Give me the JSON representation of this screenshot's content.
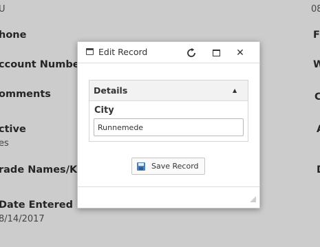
{
  "background": {
    "left_fields": [
      {
        "label": "",
        "value": "U"
      },
      {
        "label": "hone",
        "value": ""
      },
      {
        "label": "ccount Number",
        "value": ""
      },
      {
        "label": "omments",
        "value": ""
      },
      {
        "label": "ctive",
        "value": "es"
      },
      {
        "label": "rade Names/Kn",
        "value": ""
      },
      {
        "label": "Date Entered",
        "value": "8/14/2017"
      }
    ],
    "right_fields": [
      {
        "label": "",
        "value": "08"
      },
      {
        "label": "F",
        "value": ""
      },
      {
        "label": "W",
        "value": ""
      },
      {
        "label": "C",
        "value": ""
      },
      {
        "label": "A",
        "value": ""
      },
      {
        "label": "D",
        "value": ""
      }
    ]
  },
  "dialog": {
    "title": "Edit Record",
    "icons": {
      "title": "window-icon",
      "refresh": "refresh-icon",
      "maximize": "maximize-icon",
      "close": "close-icon",
      "resize": "resize-grip-icon"
    },
    "close_glyph": "✕",
    "refresh_glyph": "↻",
    "panel": {
      "title": "Details",
      "collapse_glyph": "▲",
      "field_label": "City",
      "field_value": "Runnemede"
    },
    "save_button": {
      "label": "Save Record",
      "icon": "save-icon"
    }
  }
}
